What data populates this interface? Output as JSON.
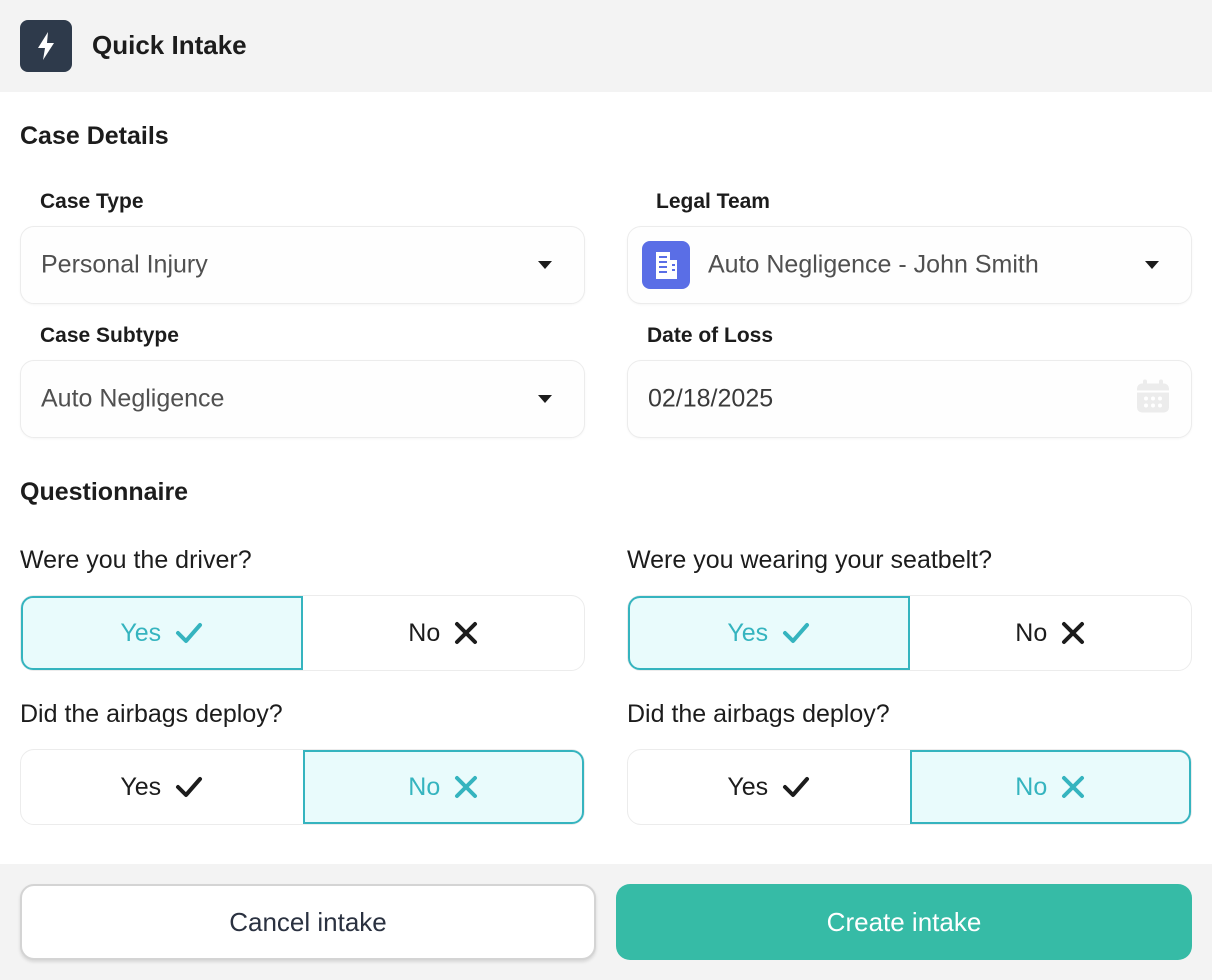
{
  "header": {
    "title": "Quick Intake",
    "logo_icon": "bolt-icon"
  },
  "case_details": {
    "section_title": "Case Details",
    "case_type": {
      "label": "Case Type",
      "value": "Personal Injury"
    },
    "legal_team": {
      "label": "Legal Team",
      "value": "Auto Negligence - John Smith",
      "icon": "building-icon"
    },
    "case_subtype": {
      "label": "Case Subtype",
      "value": "Auto Negligence"
    },
    "date_of_loss": {
      "label": "Date of Loss",
      "value": "02/18/2025"
    }
  },
  "questionnaire": {
    "section_title": "Questionnaire",
    "questions": [
      {
        "text": "Were you the driver?",
        "yes_label": "Yes",
        "no_label": "No",
        "selected": "yes"
      },
      {
        "text": "Were you wearing your seatbelt?",
        "yes_label": "Yes",
        "no_label": "No",
        "selected": "yes"
      },
      {
        "text": "Did the airbags deploy?",
        "yes_label": "Yes",
        "no_label": "No",
        "selected": "no"
      },
      {
        "text": "Did the airbags deploy?",
        "yes_label": "Yes",
        "no_label": "No",
        "selected": "no"
      }
    ]
  },
  "footer": {
    "cancel_label": "Cancel intake",
    "create_label": "Create intake"
  },
  "colors": {
    "accent": "#35b4bf",
    "primary_button": "#36bba6",
    "logo_bg": "#2e3a4b",
    "team_icon_bg": "#5a6ee6"
  }
}
